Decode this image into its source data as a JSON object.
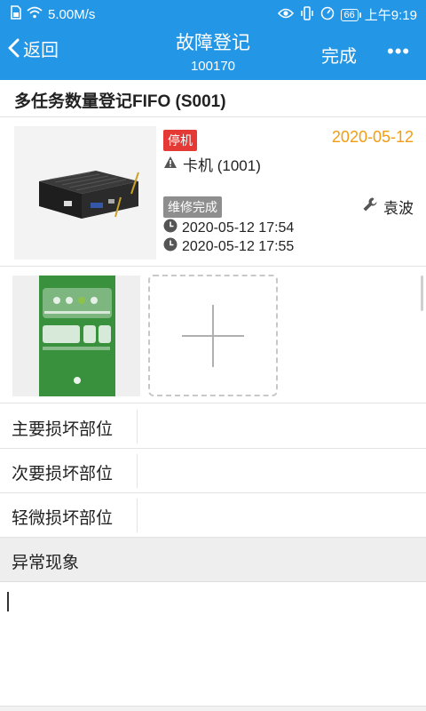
{
  "status_bar": {
    "network_speed": "5.00M/s",
    "battery": "66",
    "clock": "上午9:19",
    "icons": [
      "sim-icon",
      "wifi-icon",
      "eye-icon",
      "vibrate-icon",
      "speed-gauge-icon",
      "battery-icon"
    ]
  },
  "nav": {
    "back_label": "返回",
    "title": "故障登记",
    "subtitle": "100170",
    "done_label": "完成",
    "more_label": "•••"
  },
  "task": {
    "title": "多任务数量登记FIFO (S001)"
  },
  "device": {
    "status_tag": "停机",
    "date": "2020-05-12",
    "machine": "卡机 (1001)",
    "repair_tag": "维修完成",
    "worker": "袁波",
    "times": [
      "2020-05-12 17:54",
      "2020-05-12 17:55"
    ]
  },
  "damage": {
    "rows": [
      {
        "label": "主要损坏部位",
        "value": ""
      },
      {
        "label": "次要损坏部位",
        "value": ""
      },
      {
        "label": "轻微损坏部位",
        "value": ""
      }
    ]
  },
  "abnormal": {
    "label": "异常现象",
    "value": ""
  },
  "colors": {
    "header": "#2496e6",
    "date_accent": "#f39c12",
    "stop_tag": "#e53935",
    "repair_tag": "#8e8e8e"
  }
}
